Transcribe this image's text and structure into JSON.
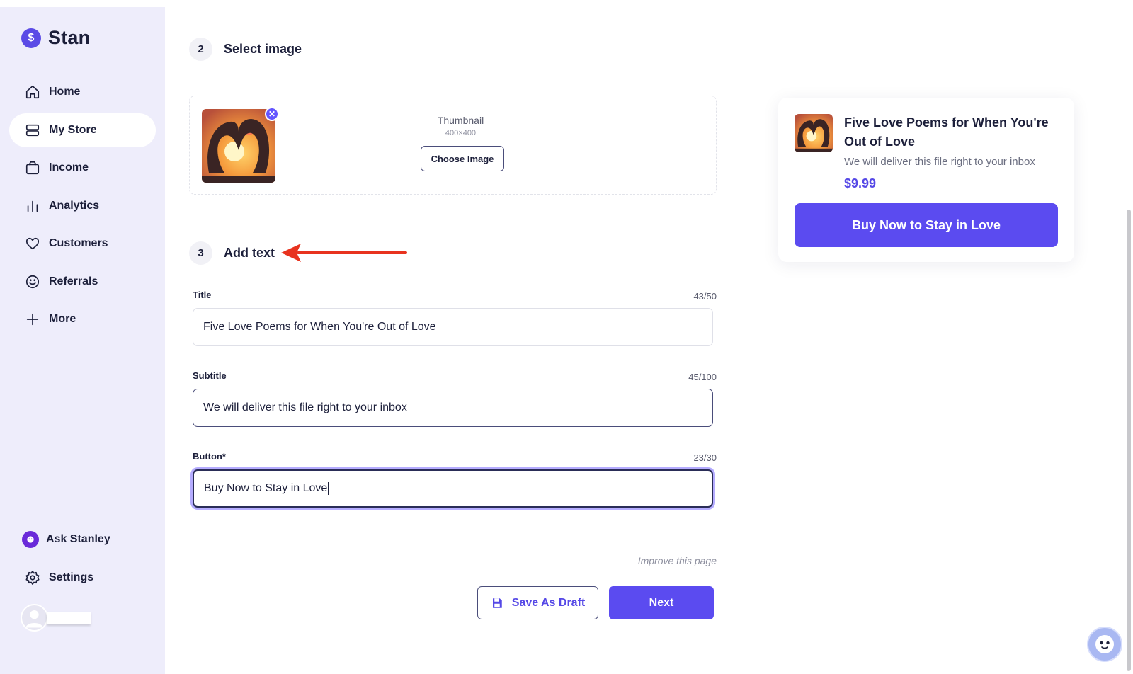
{
  "brand": {
    "name": "Stan",
    "logo_icon": "dollar-icon"
  },
  "sidebar": {
    "items": [
      {
        "label": "Home",
        "icon": "home-icon"
      },
      {
        "label": "My Store",
        "icon": "store-icon",
        "active": true
      },
      {
        "label": "Income",
        "icon": "wallet-icon"
      },
      {
        "label": "Analytics",
        "icon": "bar-chart-icon"
      },
      {
        "label": "Customers",
        "icon": "heart-icon"
      },
      {
        "label": "Referrals",
        "icon": "smile-icon"
      },
      {
        "label": "More",
        "icon": "plus-icon"
      }
    ],
    "bottom": [
      {
        "label": "Ask Stanley",
        "icon": "stanley-bot-icon"
      },
      {
        "label": "Settings",
        "icon": "gear-icon"
      }
    ]
  },
  "steps": {
    "select_image": {
      "number": "2",
      "title": "Select image"
    },
    "add_text": {
      "number": "3",
      "title": "Add text"
    }
  },
  "thumbnail": {
    "label": "Thumbnail",
    "size": "400×400",
    "choose_button": "Choose Image"
  },
  "form": {
    "title": {
      "label": "Title",
      "count": "43/50",
      "value": "Five Love Poems for When You're Out of Love"
    },
    "subtitle": {
      "label": "Subtitle",
      "count": "45/100",
      "value": "We will deliver this file right to your inbox"
    },
    "button": {
      "label": "Button*",
      "count": "23/30",
      "value": "Buy Now to Stay in Love"
    }
  },
  "improve_link": "Improve this page",
  "actions": {
    "save_draft": "Save As Draft",
    "next": "Next"
  },
  "preview": {
    "title": "Five Love Poems for When You're Out of Love",
    "subtitle": "We will deliver this file right to your inbox",
    "price": "$9.99",
    "button": "Buy Now to Stay in Love"
  },
  "colors": {
    "accent": "#5b4bf0",
    "sidebar_bg": "#eeedfb",
    "annotation_arrow": "#e8331f"
  }
}
